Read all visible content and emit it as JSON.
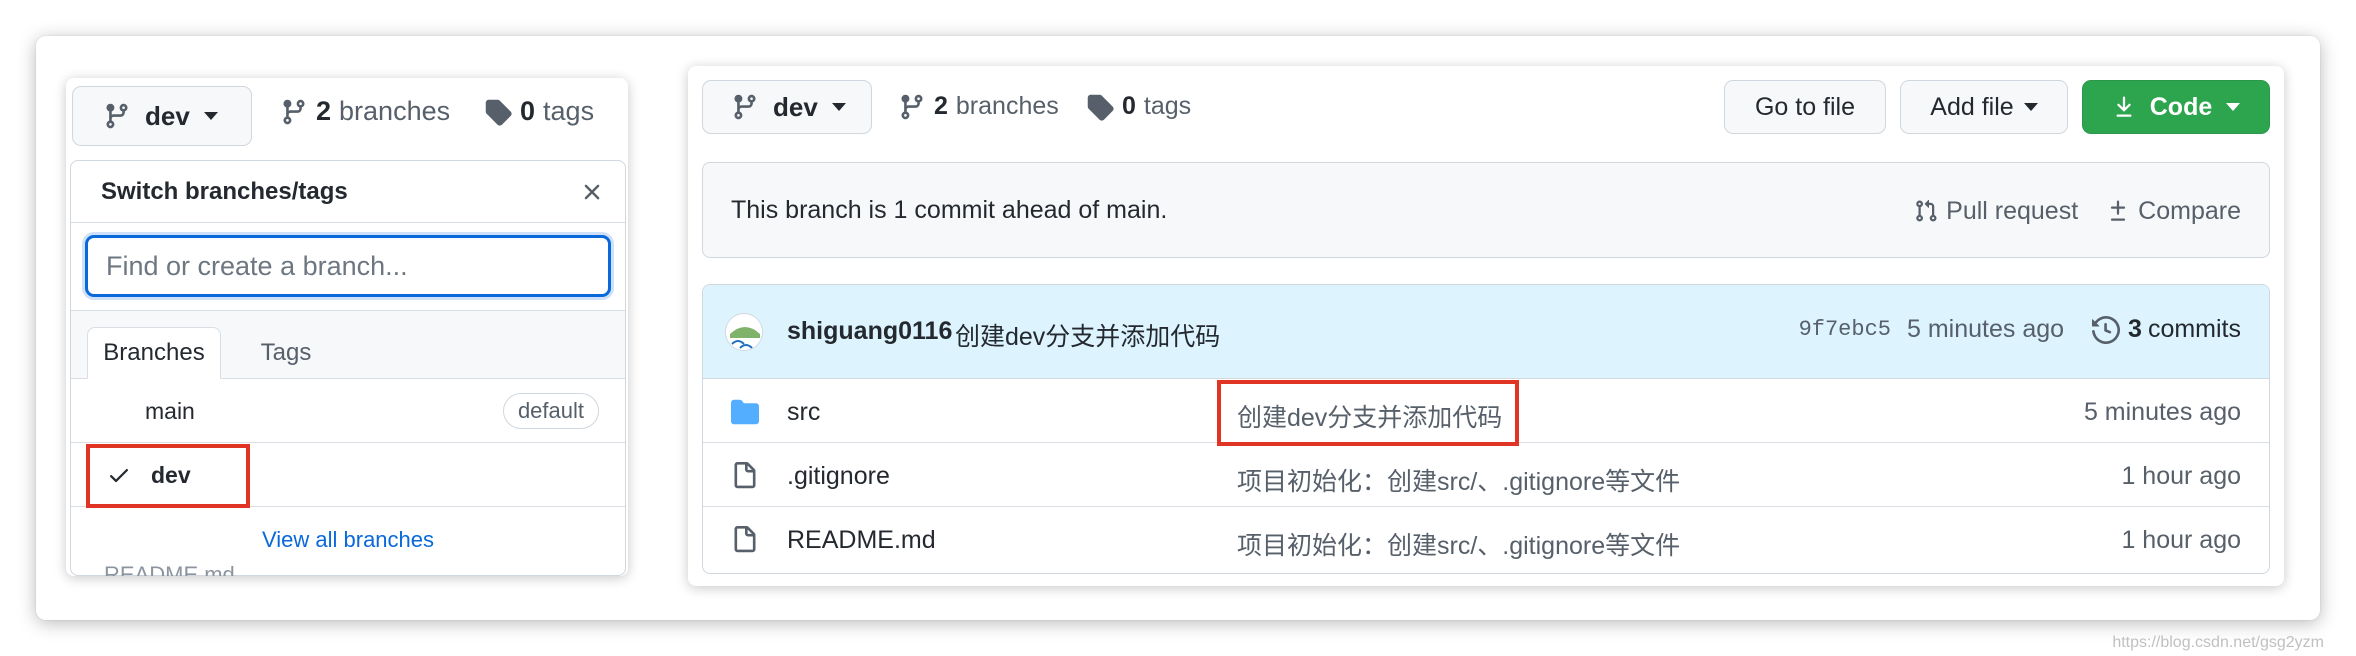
{
  "left_panel": {
    "branch_button": {
      "label": "dev"
    },
    "branches_link": {
      "count": "2",
      "label": "branches"
    },
    "tags_link": {
      "count": "0",
      "label": "tags"
    },
    "dropdown": {
      "title": "Switch branches/tags",
      "filter_placeholder": "Find or create a branch...",
      "tabs": [
        {
          "label": "Branches"
        },
        {
          "label": "Tags"
        }
      ],
      "branches": [
        {
          "name": "main",
          "badge": "default"
        },
        {
          "name": "dev"
        }
      ],
      "view_all": "View all branches",
      "peek_text": "README.md"
    }
  },
  "right_panel": {
    "branch_button": {
      "label": "dev"
    },
    "branches_link": {
      "count": "2",
      "label": "branches"
    },
    "tags_link": {
      "count": "0",
      "label": "tags"
    },
    "go_to_file": "Go to file",
    "add_file": "Add file",
    "code": "Code",
    "ahead_message": "This branch is 1 commit ahead of main.",
    "pull_request": "Pull request",
    "compare": "Compare",
    "latest_commit": {
      "author": "shiguang0116",
      "message": "创建dev分支并添加代码",
      "sha": "9f7ebc5",
      "age": "5 minutes ago",
      "commit_count": "3",
      "commits_label": "commits"
    },
    "files": [
      {
        "name": "src",
        "type": "folder",
        "message": "创建dev分支并添加代码",
        "age": "5 minutes ago"
      },
      {
        "name": ".gitignore",
        "type": "file",
        "message": "项目初始化：创建src/、.gitignore等文件",
        "age": "1 hour ago"
      },
      {
        "name": "README.md",
        "type": "file",
        "message": "项目初始化：创建src/、.gitignore等文件",
        "age": "1 hour ago"
      }
    ]
  },
  "colors": {
    "accent": "#0969da",
    "code_button": "#2da44e",
    "highlight": "#e03525",
    "commit_bar": "#ddf4ff"
  },
  "watermark": "https://blog.csdn.net/gsg2yzm"
}
